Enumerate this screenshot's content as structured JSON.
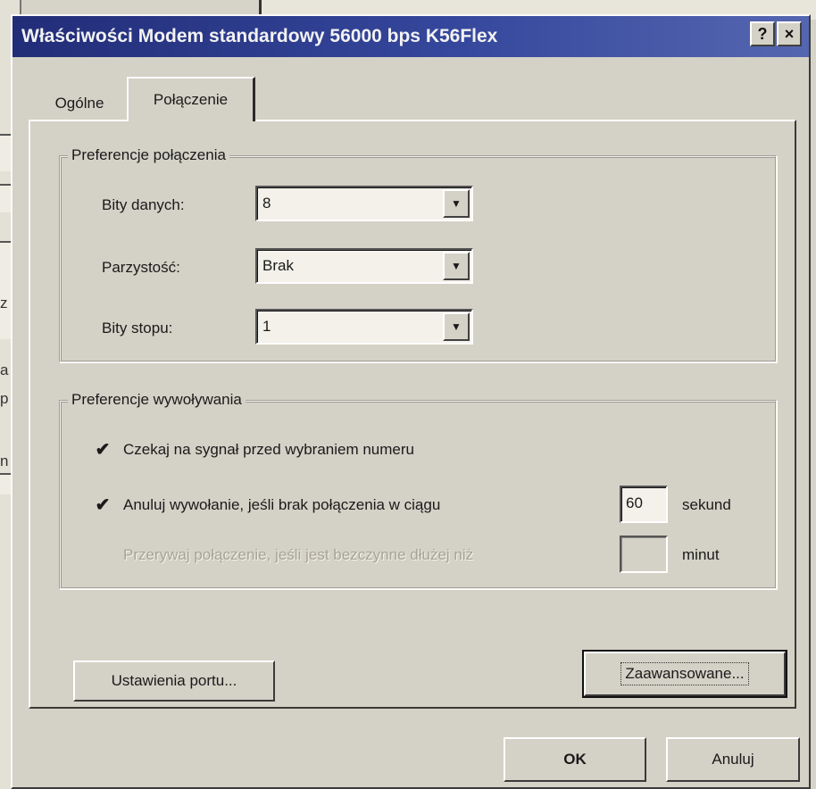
{
  "window": {
    "title": "Właściwości Modem standardowy 56000 bps K56Flex",
    "help_glyph": "?",
    "close_glyph": "×"
  },
  "background": {
    "fragments": [
      "z",
      "a",
      "p",
      "n"
    ]
  },
  "tabs": [
    {
      "label": "Ogólne",
      "active": false
    },
    {
      "label": "Połączenie",
      "active": true
    }
  ],
  "connection_prefs": {
    "legend": "Preferencje połączenia",
    "data_bits": {
      "label": "Bity danych:",
      "value": "8"
    },
    "parity": {
      "label": "Parzystość:",
      "value": "Brak"
    },
    "stop_bits": {
      "label": "Bity stopu:",
      "value": "1"
    }
  },
  "call_prefs": {
    "legend": "Preferencje wywoływania",
    "wait_tone": {
      "label": "Czekaj na sygnał przed wybraniem numeru",
      "checked": true
    },
    "cancel_call": {
      "label": "Anuluj wywołanie, jeśli brak połączenia w ciągu",
      "checked": true,
      "value": "60",
      "unit": "sekund"
    },
    "disconnect_idle": {
      "label": "Przerywaj połączenie, jeśli jest bezczynne dłużej niż",
      "checked": false,
      "enabled": false,
      "value": "",
      "unit": "minut"
    }
  },
  "buttons": {
    "port_settings": "Ustawienia portu...",
    "advanced": "Zaawansowane...",
    "ok": "OK",
    "cancel": "Anuluj"
  },
  "colors": {
    "titlebar_start": "#222d78",
    "titlebar_end": "#5566b0",
    "face": "#d4d1c6"
  }
}
